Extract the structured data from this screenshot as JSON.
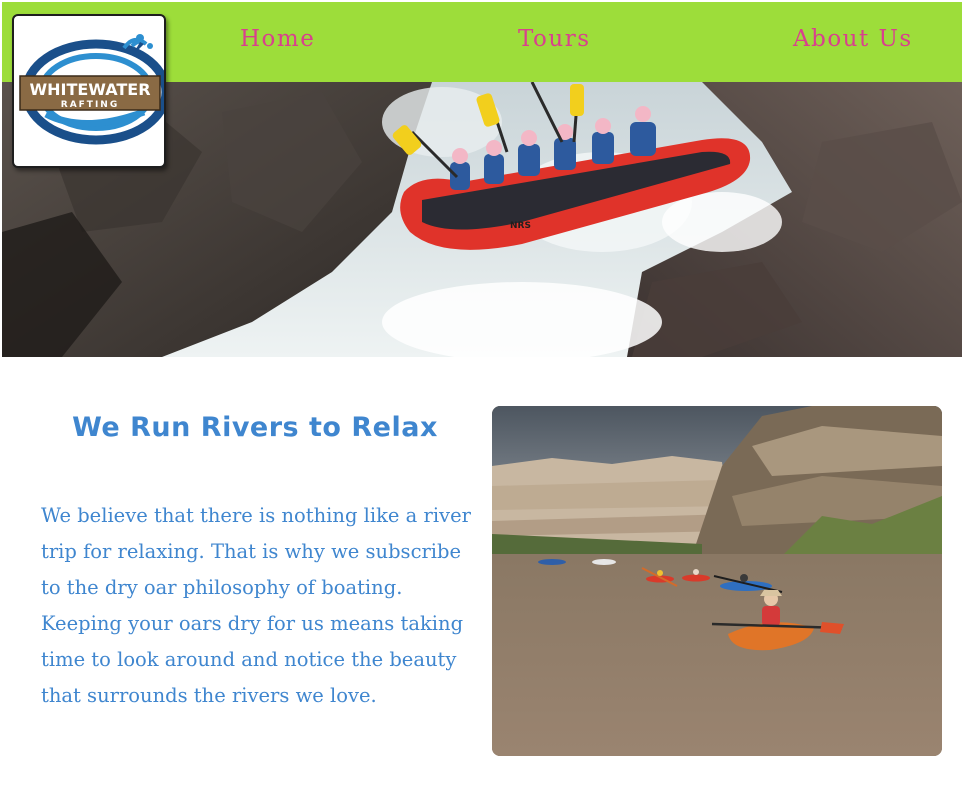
{
  "nav": {
    "items": [
      {
        "label": "Home"
      },
      {
        "label": "Tours"
      },
      {
        "label": "About Us"
      }
    ]
  },
  "logo": {
    "line1": "WHITEWATER",
    "line2": "RAFTING"
  },
  "hero": {
    "raft_brand": "NRS"
  },
  "content": {
    "heading": "We Run Rivers to Relax",
    "paragraph": "We believe that there is nothing like a river trip for relaxing. That is why we subscribe to the dry oar philosophy of boating. Keeping your oars dry for us means taking time to look around and notice the beauty that surrounds the rivers we love."
  },
  "colors": {
    "nav_background": "#9ddd3a",
    "nav_text": "#d9408d",
    "content_text": "#3f86cf"
  }
}
